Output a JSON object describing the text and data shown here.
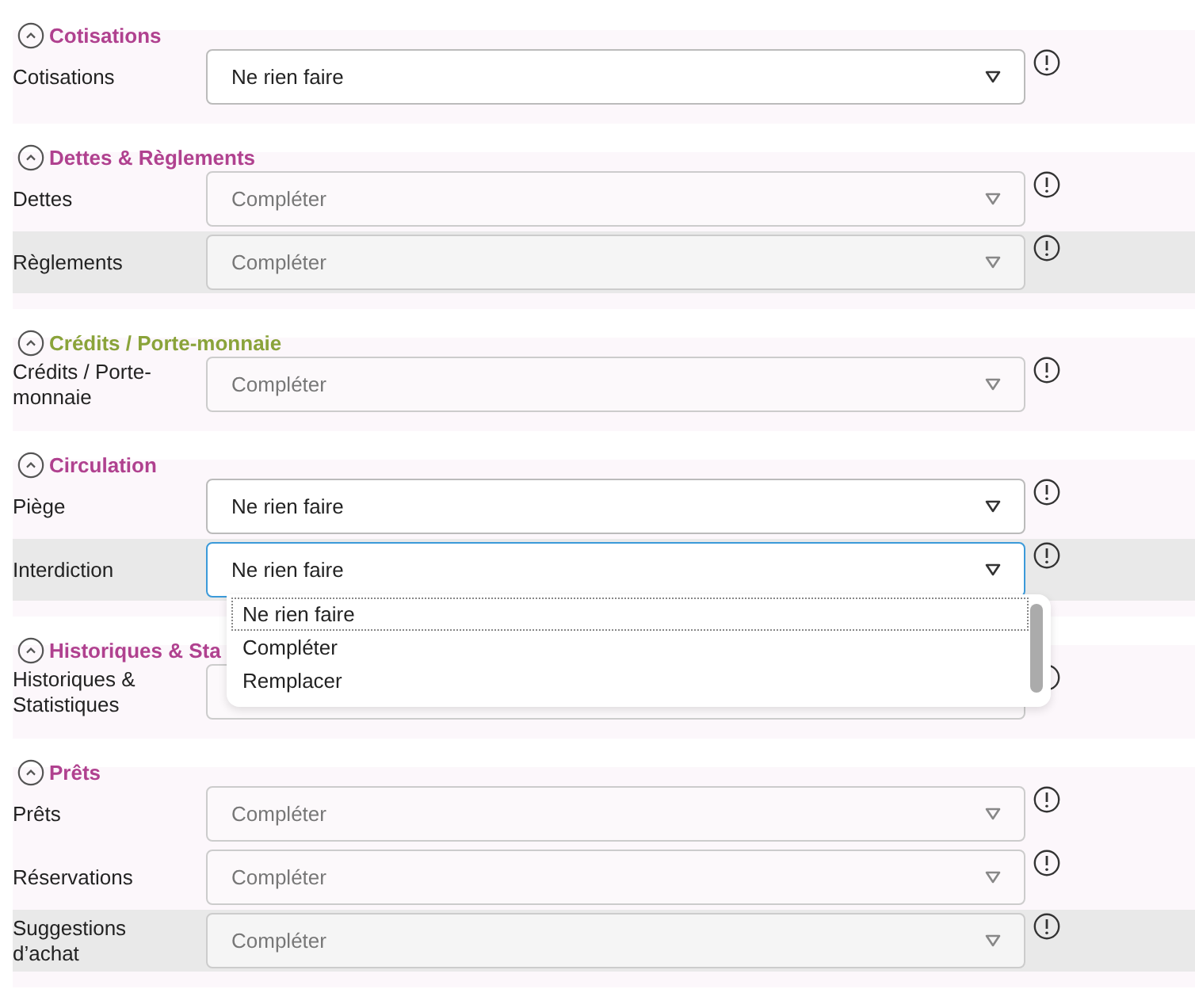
{
  "sections": [
    {
      "title": "Cotisations",
      "color": "#b0418f",
      "expanded": true,
      "rows": [
        {
          "label": "Cotisations",
          "value": "Ne rien faire",
          "highlighted": false,
          "focused": false
        }
      ]
    },
    {
      "title": "Dettes & Règlements",
      "color": "#b0418f",
      "expanded": true,
      "rows": [
        {
          "label": "Dettes",
          "placeholder": "Compléter",
          "highlighted": false,
          "focused": false
        },
        {
          "label": "Règlements",
          "placeholder": "Compléter",
          "highlighted": true,
          "focused": false
        }
      ]
    },
    {
      "title": "Crédits / Porte-monnaie",
      "color": "#8aa33a",
      "expanded": true,
      "rows": [
        {
          "label": "Crédits / Porte-monnaie",
          "placeholder": "Compléter",
          "highlighted": false,
          "focused": false
        }
      ]
    },
    {
      "title": "Circulation",
      "color": "#b0418f",
      "expanded": true,
      "rows": [
        {
          "label": "Piège",
          "value": "Ne rien faire",
          "highlighted": false,
          "focused": false
        },
        {
          "label": "Interdiction",
          "value": "Ne rien faire",
          "highlighted": true,
          "focused": true,
          "options": [
            {
              "label": "Ne rien faire",
              "selected": true
            },
            {
              "label": "Compléter",
              "selected": false
            },
            {
              "label": "Remplacer",
              "selected": false
            }
          ]
        }
      ]
    },
    {
      "title": "Historiques & Sta",
      "color": "#b0418f",
      "expanded": true,
      "rows": [
        {
          "label": "Historiques & Statistiques",
          "highlighted": false,
          "focused": false
        }
      ]
    },
    {
      "title": "Prêts",
      "color": "#b0418f",
      "expanded": true,
      "rows": [
        {
          "label": "Prêts",
          "placeholder": "Compléter",
          "highlighted": false,
          "focused": false
        },
        {
          "label": "Réservations",
          "placeholder": "Compléter",
          "highlighted": false,
          "focused": false
        },
        {
          "label": "Suggestions d’achat",
          "placeholder": "Compléter",
          "highlighted": true,
          "focused": false
        }
      ]
    }
  ]
}
